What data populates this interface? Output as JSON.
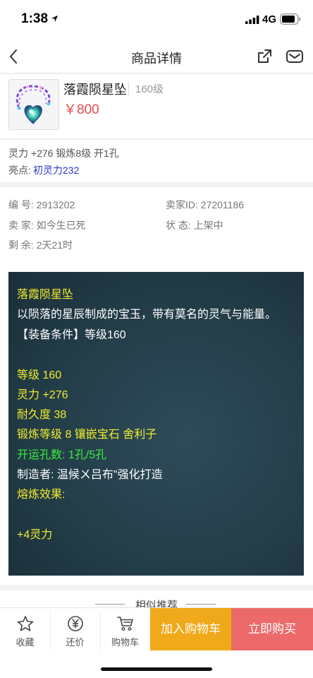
{
  "status": {
    "time": "1:38",
    "network": "4G"
  },
  "nav": {
    "title": "商品详情"
  },
  "product": {
    "name": "落霞陨星坠",
    "level": "160级",
    "price": "￥800"
  },
  "attrs": {
    "line": "灵力 +276 锻炼8级 开1孔",
    "highlight_label": "亮点:",
    "highlight_value": "初灵力232"
  },
  "info": {
    "serial": "编 号: 2913202",
    "seller_id": "卖家ID: 27201186",
    "seller": "卖 家: 如今生已死",
    "state": "状 态: 上架中",
    "remaining": "剩 余: 2天21时"
  },
  "description": {
    "name": "落霞陨星坠",
    "intro": "以陨落的星辰制成的宝玉，带有莫名的灵气与能量。",
    "requirement": "【装备条件】等级160",
    "level": "等级 160",
    "spirit": "灵力 +276",
    "durability": "耐久度 38",
    "forge": "锻炼等级 8 镶嵌宝石 舍利子",
    "holes": "开运孔数: 1孔/5孔",
    "maker": "制造者: 温候ㄨ吕布\"强化打造",
    "smelt": "熔炼效果:",
    "smelt_value": "+4灵力"
  },
  "related": {
    "title": "相似推荐"
  },
  "bottom": {
    "favorite": "收藏",
    "bargain": "还价",
    "cart": "购物车",
    "add_cart": "加入购物车",
    "buy_now": "立即购买"
  },
  "colors": {
    "price": "#e44e4e",
    "highlight": "#2a36c8",
    "desc_yellow": "#f1ec2c",
    "desc_green": "#39ee39",
    "cart_button": "#f0a91a",
    "buy_button": "#ec6a6a"
  },
  "icons": {
    "back": "chevron-left-icon",
    "share": "share-icon",
    "message": "mail-icon",
    "favorite": "star-icon",
    "bargain": "yen-circle-icon",
    "cart": "shopping-cart-icon"
  }
}
